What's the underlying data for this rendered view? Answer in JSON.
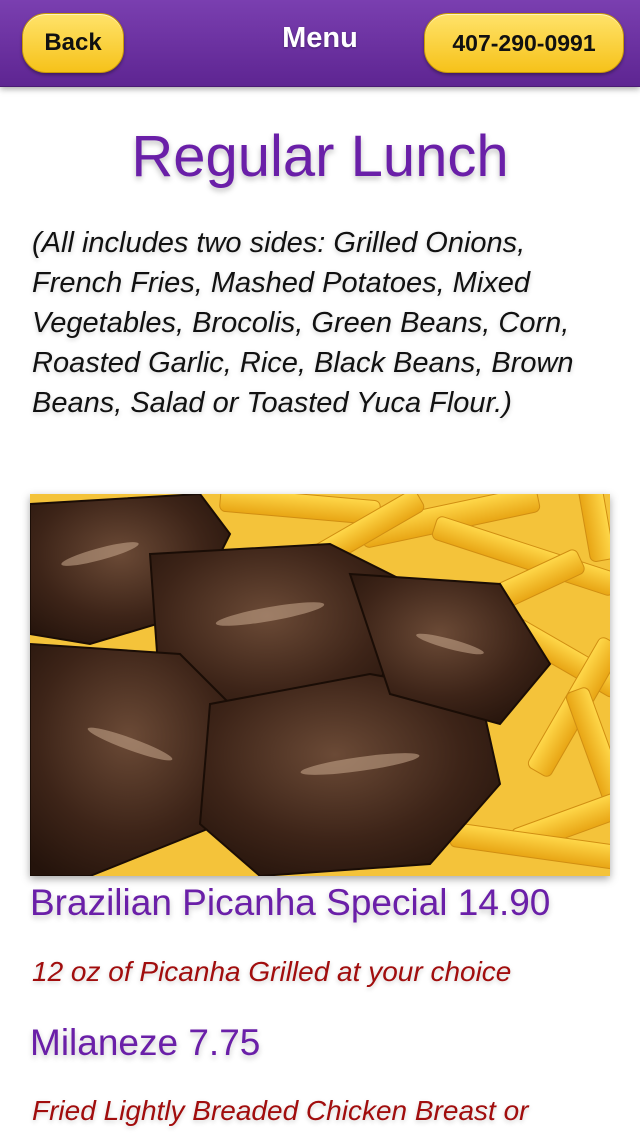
{
  "navbar": {
    "back_label": "Back",
    "title": "Menu",
    "phone_label": "407-290-0991"
  },
  "page": {
    "title": "Regular Lunch",
    "intro": "(All includes two sides: Grilled Onions, French Fries, Mashed Potatoes, Mixed Vegetables, Brocolis, Green Beans, Corn, Roasted Garlic, Rice, Black Beans, Brown Beans, Salad or Toasted Yuca Flour.)"
  },
  "items": [
    {
      "name": "Brazilian Picanha Special 14.90",
      "description": "12 oz of Picanha Grilled at your choice"
    },
    {
      "name": "Milaneze 7.75",
      "description": "Fried Lightly Breaded Chicken Breast or"
    }
  ],
  "colors": {
    "navbar": "#6a2da0",
    "button": "#f8cc2a",
    "title": "#6a1fa8",
    "description": "#a10d0d"
  }
}
